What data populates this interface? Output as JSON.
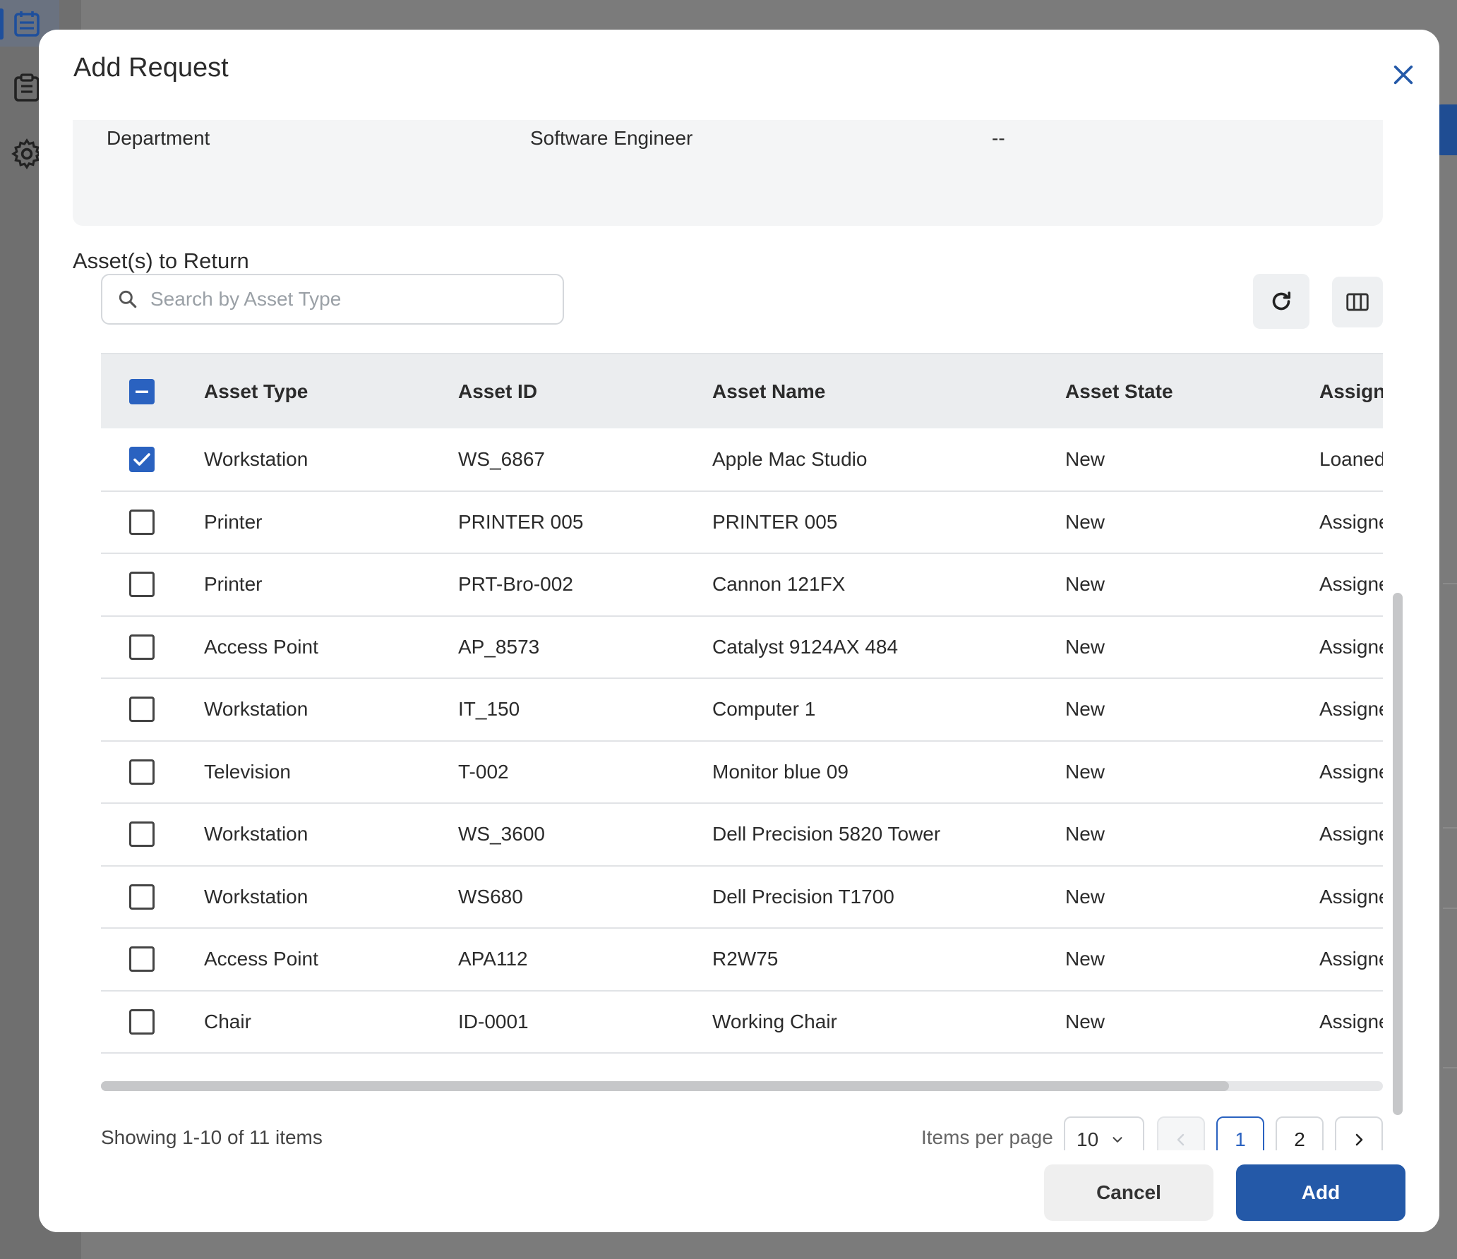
{
  "modal": {
    "title": "Add Request"
  },
  "info_row": {
    "col1": "Department",
    "col2": "Software Engineer",
    "col3": "--"
  },
  "section_title": "Asset(s) to Return",
  "search": {
    "placeholder": "Search by Asset Type",
    "value": ""
  },
  "table": {
    "columns": [
      "Asset Type",
      "Asset ID",
      "Asset Name",
      "Asset State",
      "Assign"
    ],
    "rows": [
      {
        "checked": true,
        "type": "Workstation",
        "id": "WS_6867",
        "name": "Apple Mac Studio",
        "state": "New",
        "assign": "Loaned"
      },
      {
        "checked": false,
        "type": "Printer",
        "id": "PRINTER 005",
        "name": "PRINTER 005",
        "state": "New",
        "assign": "Assigned"
      },
      {
        "checked": false,
        "type": "Printer",
        "id": "PRT-Bro-002",
        "name": "Cannon 121FX",
        "state": "New",
        "assign": "Assigned"
      },
      {
        "checked": false,
        "type": "Access Point",
        "id": "AP_8573",
        "name": "Catalyst 9124AX 484",
        "state": "New",
        "assign": "Assigned"
      },
      {
        "checked": false,
        "type": "Workstation",
        "id": "IT_150",
        "name": "Computer 1",
        "state": "New",
        "assign": "Assigned"
      },
      {
        "checked": false,
        "type": "Television",
        "id": "T-002",
        "name": "Monitor blue 09",
        "state": "New",
        "assign": "Assigned"
      },
      {
        "checked": false,
        "type": "Workstation",
        "id": "WS_3600",
        "name": "Dell Precision 5820 Tower",
        "state": "New",
        "assign": "Assigned"
      },
      {
        "checked": false,
        "type": "Workstation",
        "id": "WS680",
        "name": "Dell Precision T1700",
        "state": "New",
        "assign": "Assigned"
      },
      {
        "checked": false,
        "type": "Access Point",
        "id": "APA112",
        "name": "R2W75",
        "state": "New",
        "assign": "Assigned"
      },
      {
        "checked": false,
        "type": "Chair",
        "id": "ID-0001",
        "name": "Working Chair",
        "state": "New",
        "assign": "Assigned"
      }
    ]
  },
  "pagination": {
    "showing": "Showing 1-10 of 11 items",
    "items_per_page_label": "Items per page",
    "items_per_page_value": "10",
    "pages": [
      "1",
      "2"
    ],
    "current_page": "1"
  },
  "footer": {
    "cancel_label": "Cancel",
    "add_label": "Add"
  },
  "colors": {
    "primary": "#2459a8",
    "checkbox": "#2a62c0"
  }
}
